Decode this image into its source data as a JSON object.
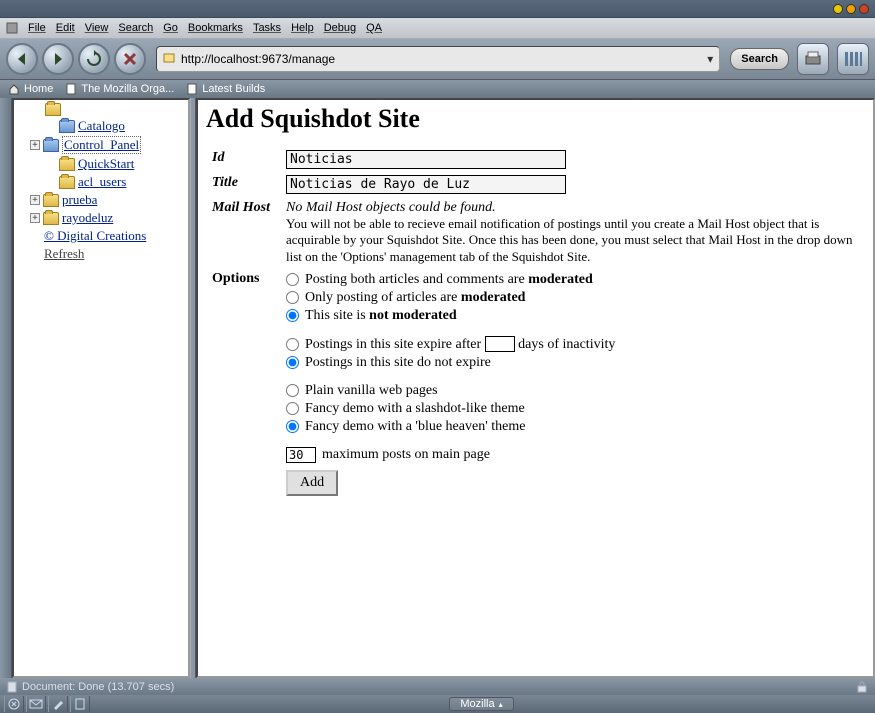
{
  "menu": {
    "file": "File",
    "edit": "Edit",
    "view": "View",
    "search": "Search",
    "go": "Go",
    "bookmarks": "Bookmarks",
    "tasks": "Tasks",
    "help": "Help",
    "debug": "Debug",
    "qa": "QA"
  },
  "toolbar": {
    "url": "http://localhost:9673/manage",
    "search_label": "Search"
  },
  "personal": {
    "home": "Home",
    "mozilla": "The Mozilla Orga...",
    "latest": "Latest Builds"
  },
  "tree": {
    "items": [
      {
        "label": "Catalogo"
      },
      {
        "label": "Control_Panel"
      },
      {
        "label": "QuickStart"
      },
      {
        "label": "acl_users"
      },
      {
        "label": "prueba"
      },
      {
        "label": "rayodeluz"
      }
    ],
    "copyright": "© Digital Creations",
    "refresh": "Refresh"
  },
  "page": {
    "heading": "Add Squishdot Site",
    "labels": {
      "id": "Id",
      "title": "Title",
      "mailhost": "Mail Host",
      "options": "Options"
    },
    "fields": {
      "id": "Noticias",
      "title": "Noticias de Rayo de Luz"
    },
    "mailhost_hint1": "No Mail Host objects could be found.",
    "mailhost_hint2": "You will not be able to recieve email notification of postings until you create a Mail Host object that is acquirable by your Squishdot Site. Once this has been done, you must select that Mail Host in the drop down list on the 'Options' management tab of the Squishdot Site.",
    "opt_mod": {
      "a": "Posting both articles and comments are ",
      "a2": "moderated",
      "b": "Only posting of articles are ",
      "b2": "moderated",
      "c": "This site is ",
      "c2": "not moderated"
    },
    "opt_exp": {
      "a1": "Postings in this site expire after ",
      "a2": " days of inactivity",
      "b": "Postings in this site do not expire",
      "days": ""
    },
    "opt_theme": {
      "a": "Plain vanilla web pages",
      "b": "Fancy demo with a slashdot-like theme",
      "c": "Fancy demo with a 'blue heaven' theme"
    },
    "maxposts": {
      "value": "30",
      "label": " maximum posts on main page"
    },
    "add": "Add"
  },
  "status": {
    "text": "Document: Done (13.707 secs)"
  },
  "taskbar": {
    "mozilla": "Mozilla"
  }
}
